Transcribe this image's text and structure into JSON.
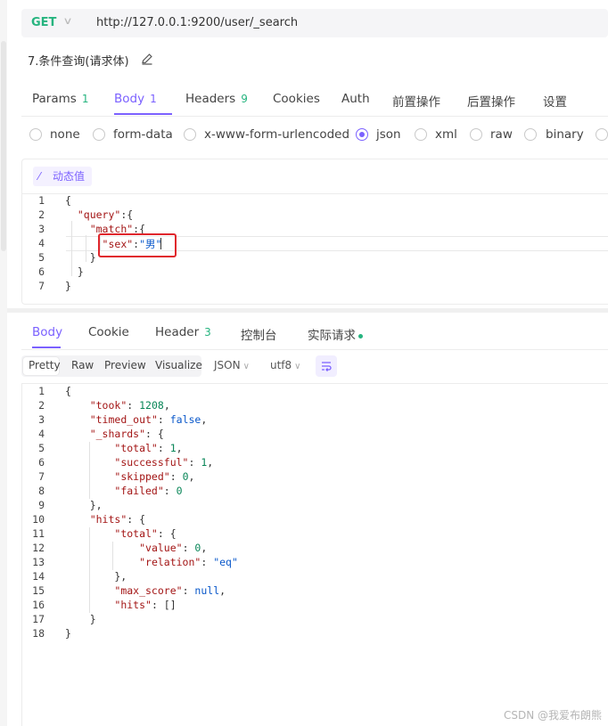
{
  "request": {
    "method": "GET",
    "url": "http://127.0.0.1:9200/user/_search",
    "title": "7.条件查询(请求体)"
  },
  "request_tabs": [
    {
      "label": "Params",
      "count": "1"
    },
    {
      "label": "Body",
      "count": "1"
    },
    {
      "label": "Headers",
      "count": "9"
    },
    {
      "label": "Cookies",
      "count": ""
    },
    {
      "label": "Auth",
      "count": ""
    },
    {
      "label": "前置操作",
      "count": ""
    },
    {
      "label": "后置操作",
      "count": ""
    },
    {
      "label": "设置",
      "count": ""
    }
  ],
  "active_request_tab": "Body",
  "body_types": [
    "none",
    "form-data",
    "x-www-form-urlencoded",
    "json",
    "xml",
    "raw",
    "binary"
  ],
  "selected_body_type": "json",
  "dynamic_value_label": "动态值",
  "request_body": {
    "line_numbers": [
      "1",
      "2",
      "3",
      "4",
      "5",
      "6",
      "7"
    ],
    "lines": [
      "{",
      "  \"query\":{",
      "    \"match\":{",
      "      \"sex\":\"男\"",
      "    }",
      "  }",
      "}"
    ]
  },
  "response_tabs": [
    {
      "label": "Body",
      "count": ""
    },
    {
      "label": "Cookie",
      "count": ""
    },
    {
      "label": "Header",
      "count": "3"
    },
    {
      "label": "控制台",
      "count": ""
    },
    {
      "label": "实际请求",
      "count": ""
    }
  ],
  "active_response_tab": "Body",
  "view_modes": [
    "Pretty",
    "Raw",
    "Preview",
    "Visualize"
  ],
  "active_view_mode": "Pretty",
  "format": "JSON",
  "encoding": "utf8",
  "response_body": {
    "line_numbers": [
      "1",
      "2",
      "3",
      "4",
      "5",
      "6",
      "7",
      "8",
      "9",
      "10",
      "11",
      "12",
      "13",
      "14",
      "15",
      "16",
      "17",
      "18"
    ],
    "lines": [
      "{",
      "    \"took\": 1208,",
      "    \"timed_out\": false,",
      "    \"_shards\": {",
      "        \"total\": 1,",
      "        \"successful\": 1,",
      "        \"skipped\": 0,",
      "        \"failed\": 0",
      "    },",
      "    \"hits\": {",
      "        \"total\": {",
      "            \"value\": 0,",
      "            \"relation\": \"eq\"",
      "        },",
      "        \"max_score\": null,",
      "        \"hits\": []",
      "    }",
      "}"
    ]
  },
  "watermark": "CSDN @我爱布朗熊",
  "colors": {
    "accent": "#7b61ff",
    "method_get": "#26b47f",
    "highlight_box": "#e0262c"
  },
  "icons": [
    "chevron-down-icon",
    "edit-icon",
    "magic-wand-icon",
    "wrap-lines-icon"
  ]
}
